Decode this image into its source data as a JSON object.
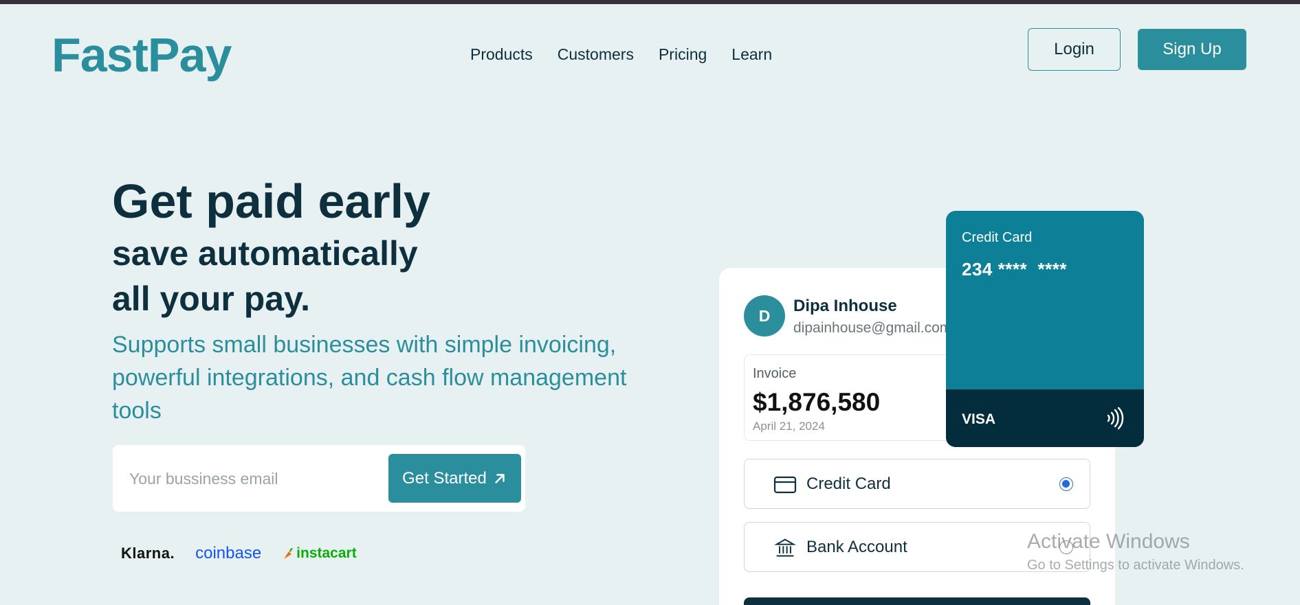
{
  "header": {
    "logo": "FastPay",
    "nav": [
      "Products",
      "Customers",
      "Pricing",
      "Learn"
    ],
    "login_label": "Login",
    "signup_label": "Sign Up"
  },
  "hero": {
    "line1": "Get paid early",
    "line2": "save automatically",
    "line3": "all your pay.",
    "subtitle": "Supports small businesses with simple invoicing, powerful integrations, and cash flow management tools",
    "email_placeholder": "Your bussiness email",
    "cta_label": "Get Started",
    "brands": [
      "Klarna.",
      "coinbase",
      "instacart"
    ]
  },
  "payment": {
    "avatar_initial": "D",
    "user_name": "Dipa Inhouse",
    "user_email": "dipainhouse@gmail.com",
    "invoice_label": "Invoice",
    "invoice_amount": "$1,876,580",
    "invoice_date": "April 21, 2024",
    "methods": [
      {
        "label": "Credit Card",
        "icon": "credit-card-icon",
        "selected": true
      },
      {
        "label": "Bank Account",
        "icon": "bank-icon",
        "selected": false
      }
    ]
  },
  "credit_card": {
    "title": "Credit Card",
    "number": "234 ****  ****",
    "brand": "VISA",
    "contactless_icon": "contactless-icon"
  },
  "watermark": {
    "title": "Activate Windows",
    "subtitle": "Go to Settings to activate Windows."
  },
  "colors": {
    "background": "#e8f1f2",
    "accent": "#2b8e9c",
    "dark": "#0e2f3e",
    "card": "#0d8098",
    "card_dark": "#032c3c"
  }
}
